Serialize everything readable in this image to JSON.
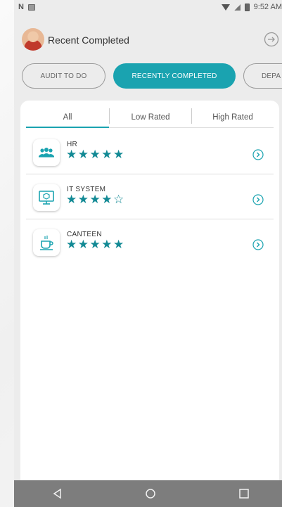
{
  "status_bar": {
    "time": "9:52 AM"
  },
  "header": {
    "title": "Recent Completed"
  },
  "tabs": [
    {
      "label": "AUDIT TO DO",
      "active": false
    },
    {
      "label": "RECENTLY COMPLETED",
      "active": true
    },
    {
      "label": "DEPA",
      "active": false
    }
  ],
  "filters": [
    {
      "label": "All",
      "active": true
    },
    {
      "label": "Low Rated",
      "active": false
    },
    {
      "label": "High Rated",
      "active": false
    }
  ],
  "items": [
    {
      "title": "HR",
      "stars": "★★★★★",
      "icon": "people-icon",
      "rating": 5
    },
    {
      "title": "IT SYSTEM",
      "stars": "★★★★☆",
      "icon": "computer-icon",
      "rating": 4
    },
    {
      "title": "CANTEEN",
      "stars": "★★★★★",
      "icon": "coffee-cup-icon",
      "rating": 5
    }
  ],
  "colors": {
    "accent": "#1aa3b0",
    "star": "#138a95",
    "navbar": "#7d7d7d"
  },
  "navigation": {
    "back": "back-icon",
    "home": "home-icon",
    "recents": "recents-icon"
  }
}
